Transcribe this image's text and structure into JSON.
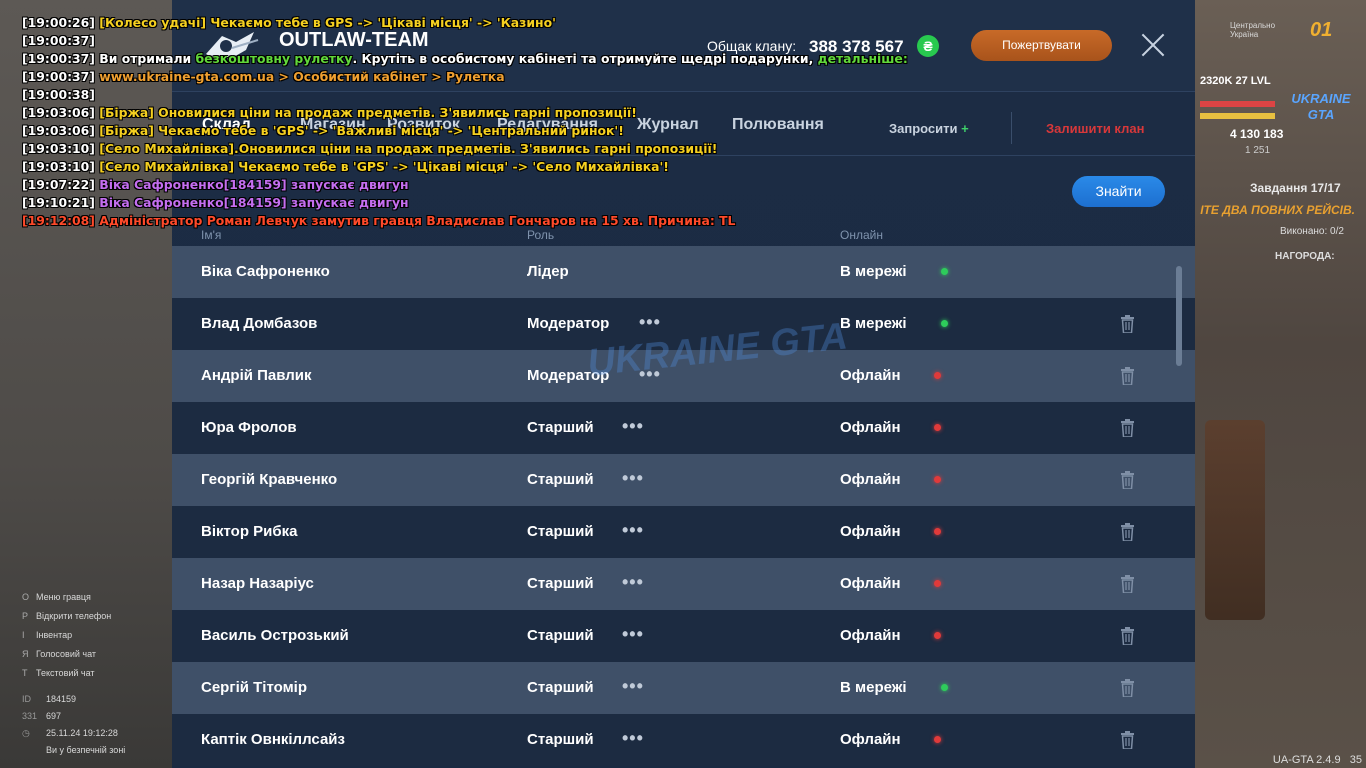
{
  "hud": {
    "region": "Центрально Україна",
    "region_num": "01",
    "level": "2320K  27 LVL",
    "money": "4 130 183",
    "money_secondary": "1 251",
    "logo": "UKRAINE GTA",
    "task_title": "Завдання 17/17",
    "task_desc": "ІТЕ ДВА ПОВНИХ РЕЙСІВ.",
    "task_done": "Виконано: 0/2",
    "task_reward": "НАГОРОДА:",
    "help": [
      {
        "key": "О",
        "label": "Меню гравця"
      },
      {
        "key": "Р",
        "label": "Відкрити телефон"
      },
      {
        "key": "І",
        "label": "Інвентар"
      },
      {
        "key": "Я",
        "label": "Голосовий чат"
      },
      {
        "key": "Т",
        "label": "Текстовий чат"
      }
    ],
    "stats": [
      {
        "k": "ID",
        "v": "184159"
      },
      {
        "k": "331",
        "v": "697"
      },
      {
        "k": "◷",
        "v": "25.11.24 19:12:28"
      },
      {
        "k": "",
        "v": "Ви у безпечній зоні"
      }
    ],
    "version": "UA-GTA 2.4.9",
    "version_extra": "35"
  },
  "panel": {
    "clan_name": "OUTLAW-TEAM",
    "clan_site": "Склад",
    "balance_label": "Общак клану:",
    "balance_value": "388 378 567",
    "currency_symbol": "₴",
    "donate_label": "Пожертвувати",
    "tabs": [
      "Склад",
      "Магазин",
      "Розвиток",
      "Редагування",
      "Журнал",
      "Полювання"
    ],
    "invite_label": "Запросити",
    "invite_plus": "+",
    "leave_label": "Залишити клан",
    "search_placeholder": "",
    "find_label": "Знайти",
    "columns": {
      "name": "Ім'я",
      "role": "Роль",
      "online": "Онлайн"
    },
    "members": [
      {
        "name": "Віка Сафроненко",
        "role": "Лідер",
        "status": "В мережі",
        "online": true,
        "dots": false,
        "trash": false
      },
      {
        "name": "Влад Домбазов",
        "role": "Модератор",
        "status": "В мережі",
        "online": true,
        "dots": true,
        "trash": true
      },
      {
        "name": "Андрій Павлик",
        "role": "Модератор",
        "status": "Офлайн",
        "online": false,
        "dots": true,
        "trash": true
      },
      {
        "name": "Юра Фролов",
        "role": "Старший",
        "status": "Офлайн",
        "online": false,
        "dots": true,
        "trash": true
      },
      {
        "name": "Георгій Кравченко",
        "role": "Старший",
        "status": "Офлайн",
        "online": false,
        "dots": true,
        "trash": true
      },
      {
        "name": "Віктор Рибка",
        "role": "Старший",
        "status": "Офлайн",
        "online": false,
        "dots": true,
        "trash": true
      },
      {
        "name": "Назар Назаріус",
        "role": "Старший",
        "status": "Офлайн",
        "online": false,
        "dots": true,
        "trash": true
      },
      {
        "name": "Василь Острозький",
        "role": "Старший",
        "status": "Офлайн",
        "online": false,
        "dots": true,
        "trash": true
      },
      {
        "name": "Сергій Тітомір",
        "role": "Старший",
        "status": "В мережі",
        "online": true,
        "dots": true,
        "trash": true
      },
      {
        "name": "Каптік Овнкіллсайз",
        "role": "Старший",
        "status": "Офлайн",
        "online": false,
        "dots": true,
        "trash": true
      }
    ],
    "watermark": "UKRAINE GTA"
  },
  "chat": [
    [
      {
        "c": "ts",
        "t": "[19:00:26] "
      },
      {
        "c": "c-yellow",
        "t": "[Колесо удачі] Чекаємо тебе в GPS -> 'Цікаві місця' -> 'Казино'"
      }
    ],
    [
      {
        "c": "ts",
        "t": "[19:00:37]"
      }
    ],
    [
      {
        "c": "ts",
        "t": "[19:00:37] "
      },
      {
        "c": "c-white",
        "t": "Ви отримали "
      },
      {
        "c": "c-green",
        "t": "безкоштовну рулетку"
      },
      {
        "c": "c-white",
        "t": ". Крутіть в особистому кабінеті та отримуйте щедрі подарунки, "
      },
      {
        "c": "c-green",
        "t": "детальніше:"
      }
    ],
    [
      {
        "c": "ts",
        "t": "[19:00:37] "
      },
      {
        "c": "c-orange",
        "t": "www.ukraine-gta.com.ua > Особистий кабінет > Рулетка"
      }
    ],
    [
      {
        "c": "ts",
        "t": "[19:00:38]"
      }
    ],
    [
      {
        "c": "ts",
        "t": "[19:03:06] "
      },
      {
        "c": "c-yellow",
        "t": "[Біржа] Оновилися ціни на продаж предметів. З'явились гарні пропозиції!"
      }
    ],
    [
      {
        "c": "ts",
        "t": "[19:03:06] "
      },
      {
        "c": "c-yellow",
        "t": "[Біржа] Чекаємо тебе в 'GPS' -> 'Важливі місця' -> 'Центральний ринок'!"
      }
    ],
    [
      {
        "c": "ts",
        "t": "[19:03:10] "
      },
      {
        "c": "c-yellow",
        "t": "[Село Михайлівка].Оновилися ціни на продаж предметів. З'явились гарні пропозиції!"
      }
    ],
    [
      {
        "c": "ts",
        "t": "[19:03:10] "
      },
      {
        "c": "c-yellow",
        "t": "[Село Михайлівка] Чекаємо тебе в 'GPS' -> 'Цікаві місця' -> 'Село Михайлівка'!"
      }
    ],
    [
      {
        "c": "ts",
        "t": "[19:07:22]  "
      },
      {
        "c": "c-purple",
        "t": "Віка Сафроненко[184159] запускає двигун"
      }
    ],
    [
      {
        "c": "ts",
        "t": "[19:10:21]  "
      },
      {
        "c": "c-purple",
        "t": "Віка Сафроненко[184159] запускає двигун"
      }
    ],
    [
      {
        "c": "c-red",
        "t": "[19:12:08] Адміністратор Роман Левчук замутив гравця Владислав Гончаров на 15 хв. Причина: TL"
      }
    ]
  ],
  "colors": {
    "accent": "#1d6fd0",
    "donate": "#b85e21",
    "online": "#2ecc5b",
    "offline": "#e03a3a",
    "leave": "#d8383a"
  }
}
